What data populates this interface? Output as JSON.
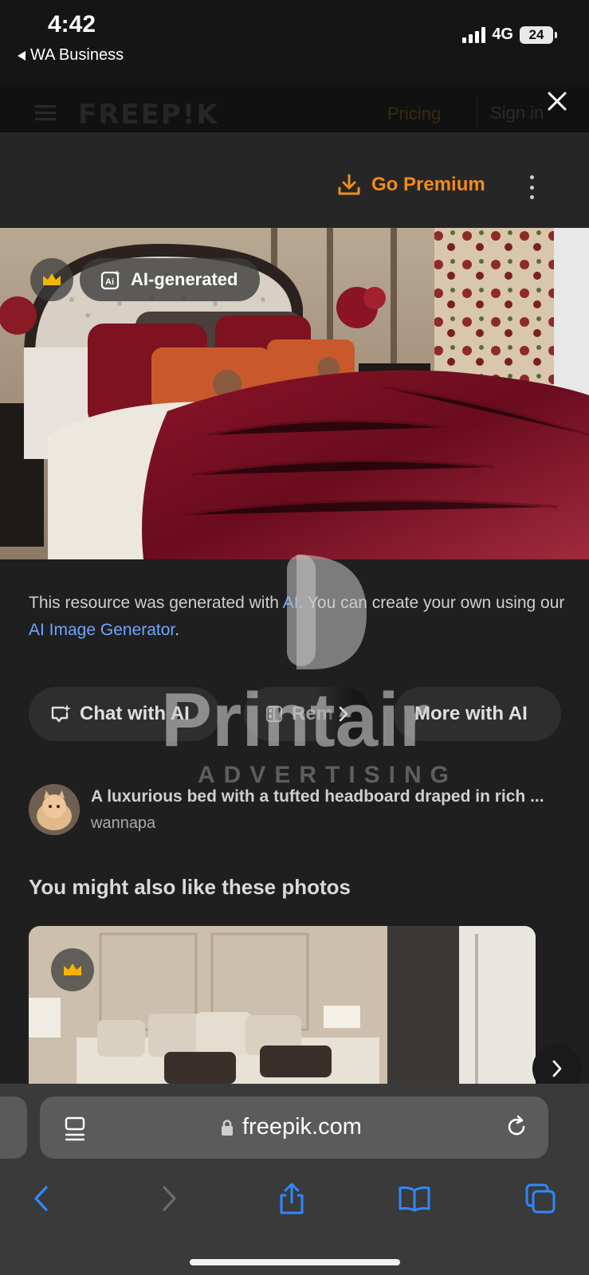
{
  "status_bar": {
    "time": "4:42",
    "back_app": "WA Business",
    "network": "4G",
    "battery": "24"
  },
  "site_header": {
    "logo": "FREEP!K",
    "pricing": "Pricing",
    "signin": "Sign in"
  },
  "panel": {
    "go_premium": "Go Premium",
    "ai_badge": "AI-generated",
    "description": {
      "part1": "This resource was generated with ",
      "link1": "AI",
      "part2": ". You can create your own using our ",
      "link2": "AI Image Generator",
      "part3": "."
    },
    "buttons": {
      "chat": "Chat with AI",
      "remove": "Rem",
      "more": "More with AI"
    },
    "photo": {
      "title": "A luxurious bed with a tufted headboard draped in rich ...",
      "author": "wannapa"
    },
    "related_title": "You might also like these photos"
  },
  "watermark": {
    "brand": "Printair",
    "tagline": "ADVERTISING"
  },
  "browser": {
    "url": "freepik.com"
  },
  "colors": {
    "accent_orange": "#f28a1f",
    "link_blue": "#6fa4ff",
    "crown": "#f5b400"
  }
}
